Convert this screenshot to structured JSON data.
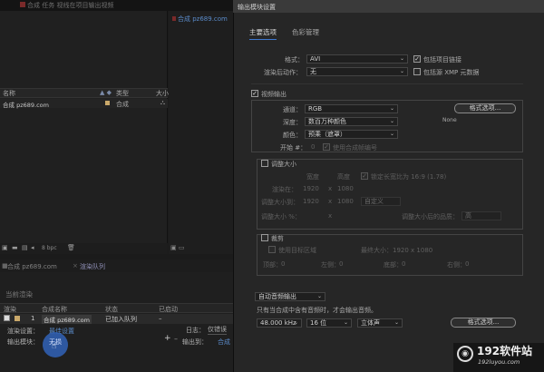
{
  "background": {
    "top_tab_title": "合成 任务 视线在项目输出视频",
    "comp_tab": "合成 pz689.com",
    "project": {
      "header_name": "名称",
      "header_type": "类型",
      "header_size": "大小",
      "row_name": "合成 pz689.com",
      "row_type": "合成"
    },
    "toolbar_bpc": "8 bpc",
    "render_queue": {
      "tab1": "合成 pz689.com",
      "tab2": "渲染队列",
      "current_render": "当前渲染",
      "col_render": "渲染",
      "col_comp_name": "合成名称",
      "col_status": "状态",
      "col_started": "已启动",
      "row_num": "1",
      "row_comp": "合成 pz689.com",
      "row_status": "已加入队列",
      "row_started": "–",
      "render_settings_label": "渲染设置：",
      "render_settings_value": "最佳设置",
      "output_module_label": "输出模块：",
      "output_module_value": "无损",
      "log_label": "日志：",
      "log_value": "仅错误",
      "output_to_label": "输出到：",
      "output_to_value": "合成"
    }
  },
  "dialog": {
    "title": "输出模块设置",
    "tabs": [
      "主要选项",
      "色彩管理"
    ],
    "format_label": "格式：",
    "format_value": "AVI",
    "include_project_link": "包括项目链接",
    "post_render_label": "渲染后动作：",
    "post_render_value": "无",
    "include_xmp": "包括源 XMP 元数据",
    "video_output": "视频输出",
    "channels_label": "通道：",
    "channels_value": "RGB",
    "format_options_btn": "格式选项...",
    "depth_label": "深度：",
    "depth_value": "数百万种颜色",
    "codec_note": "None",
    "color_label": "颜色：",
    "color_value": "预乘（遮罩）",
    "start_label": "开始 #：",
    "start_value": "0",
    "use_comp_frame": "使用合成帧编号",
    "resize": "调整大小",
    "width_hdr": "宽度",
    "height_hdr": "高度",
    "lock_aspect": "锁定长宽比为 16:9 (1.78)",
    "rendering_at": "渲染在：",
    "render_w": "1920",
    "render_h": "1080",
    "resize_to": "调整大小到：",
    "resize_w": "1920",
    "resize_h": "1080",
    "custom": "自定义",
    "resize_pct": "调整大小 %：",
    "x_sep": "x",
    "resize_quality": "调整大小后的品质：",
    "quality_value": "高",
    "crop": "裁剪",
    "use_roi": "使用目标区域",
    "final_size": "最终大小：1920 x 1080",
    "top": "顶部：",
    "left": "左侧：",
    "bottom": "底部：",
    "right": "右侧：",
    "crop_val": "0",
    "auto_audio": "自动音频输出",
    "audio_note": "只有当合成中含有音频时，才会输出音频。",
    "sample_rate": "48.000 kHz",
    "bit_depth": "16 位",
    "channels_audio": "立体声",
    "audio_format_btn": "格式选项..."
  },
  "watermark": {
    "text": "192软件站",
    "url": "192luyou.com"
  },
  "colors": {
    "accent": "#3e78d0",
    "link": "#5a8ac8",
    "dialog_bg": "#262626"
  }
}
